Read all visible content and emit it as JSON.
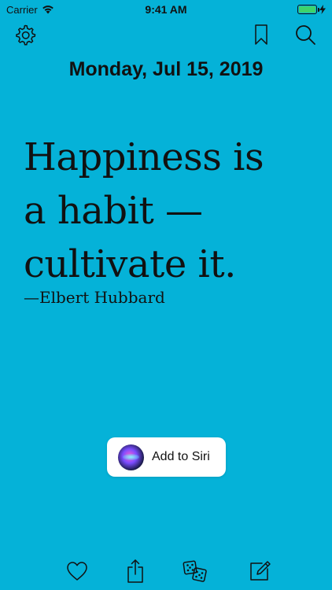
{
  "status_bar": {
    "carrier": "Carrier",
    "time": "9:41 AM"
  },
  "nav": {
    "settings_icon": "gear-icon",
    "bookmark_icon": "bookmark-icon",
    "search_icon": "search-icon"
  },
  "date": "Monday, Jul 15, 2019",
  "quote": {
    "line1": "Happiness is",
    "line2": "a habit —",
    "line3": "cultivate it.",
    "author": "—Elbert Hubbard"
  },
  "siri_button": {
    "label": "Add to Siri"
  },
  "tab_bar": {
    "items": [
      "heart-icon",
      "share-icon",
      "dice-icon",
      "compose-icon"
    ]
  },
  "colors": {
    "background": "#05B2D8",
    "text": "#111111",
    "battery": "#3ED36B"
  }
}
